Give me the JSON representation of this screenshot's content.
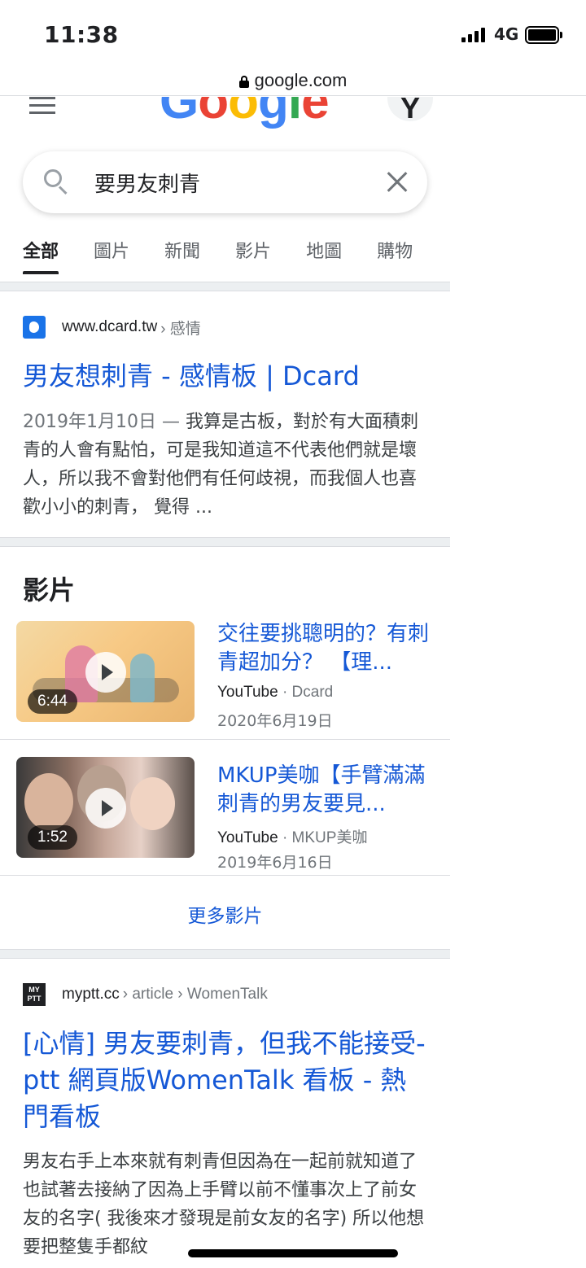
{
  "status_bar": {
    "time": "11:38",
    "network": "4G"
  },
  "url_bar": {
    "url": "google.com",
    "lock_icon": "lock-icon"
  },
  "header": {
    "logo_text": [
      "G",
      "o",
      "o",
      "g",
      "l",
      "e"
    ],
    "logo_colors": [
      "#4285F4",
      "#EA4335",
      "#FBBC05",
      "#4285F4",
      "#34A853",
      "#EA4335"
    ],
    "avatar_letter": "Y",
    "menu_icon": "hamburger-menu-icon"
  },
  "search": {
    "query": "要男友刺青",
    "search_icon": "search-icon",
    "clear_icon": "close-icon"
  },
  "tabs": [
    {
      "label": "全部",
      "active": true
    },
    {
      "label": "圖片",
      "active": false
    },
    {
      "label": "新聞",
      "active": false
    },
    {
      "label": "影片",
      "active": false
    },
    {
      "label": "地圖",
      "active": false
    },
    {
      "label": "購物",
      "active": false
    }
  ],
  "result_1": {
    "domain": "www.dcard.tw",
    "breadcrumb": "› 感情",
    "title": "男友想刺青 - 感情板 | Dcard",
    "date": "2019年1月10日 — ",
    "snippet": "我算是古板，對於有大面積刺青的人會有點怕，可是我知道這不代表他們就是壞人，所以我不會對他們有任何歧視，而我個人也喜歡小小的刺青， 覺得 ..."
  },
  "videos": {
    "heading": "影片",
    "items": [
      {
        "title": "交往要挑聰明的？有刺青超加分？ 【理...",
        "source": "YouTube",
        "channel": "· Dcard",
        "date": "2020年6月19日",
        "duration": "6:44"
      },
      {
        "title": "MKUP美咖【手臂滿滿刺青的男友要見...",
        "source": "YouTube",
        "channel": "· MKUP美咖",
        "date": "2019年6月16日",
        "duration": "1:52"
      }
    ],
    "more_label": "更多影片"
  },
  "result_2": {
    "domain": "myptt.cc",
    "breadcrumb": "› article › WomenTalk",
    "favicon_text": "MY PTT",
    "title": "[心情] 男友要刺青，但我不能接受- ptt 網頁版WomenTalk 看板 - 熱門看板",
    "snippet": "男友右手上本來就有刺青但因為在一起前就知道了也試著去接納了因為上手臂以前不懂事次上了前女友的名字( 我後來才發現是前女友的名字) 所以他想要把整隻手都紋"
  }
}
